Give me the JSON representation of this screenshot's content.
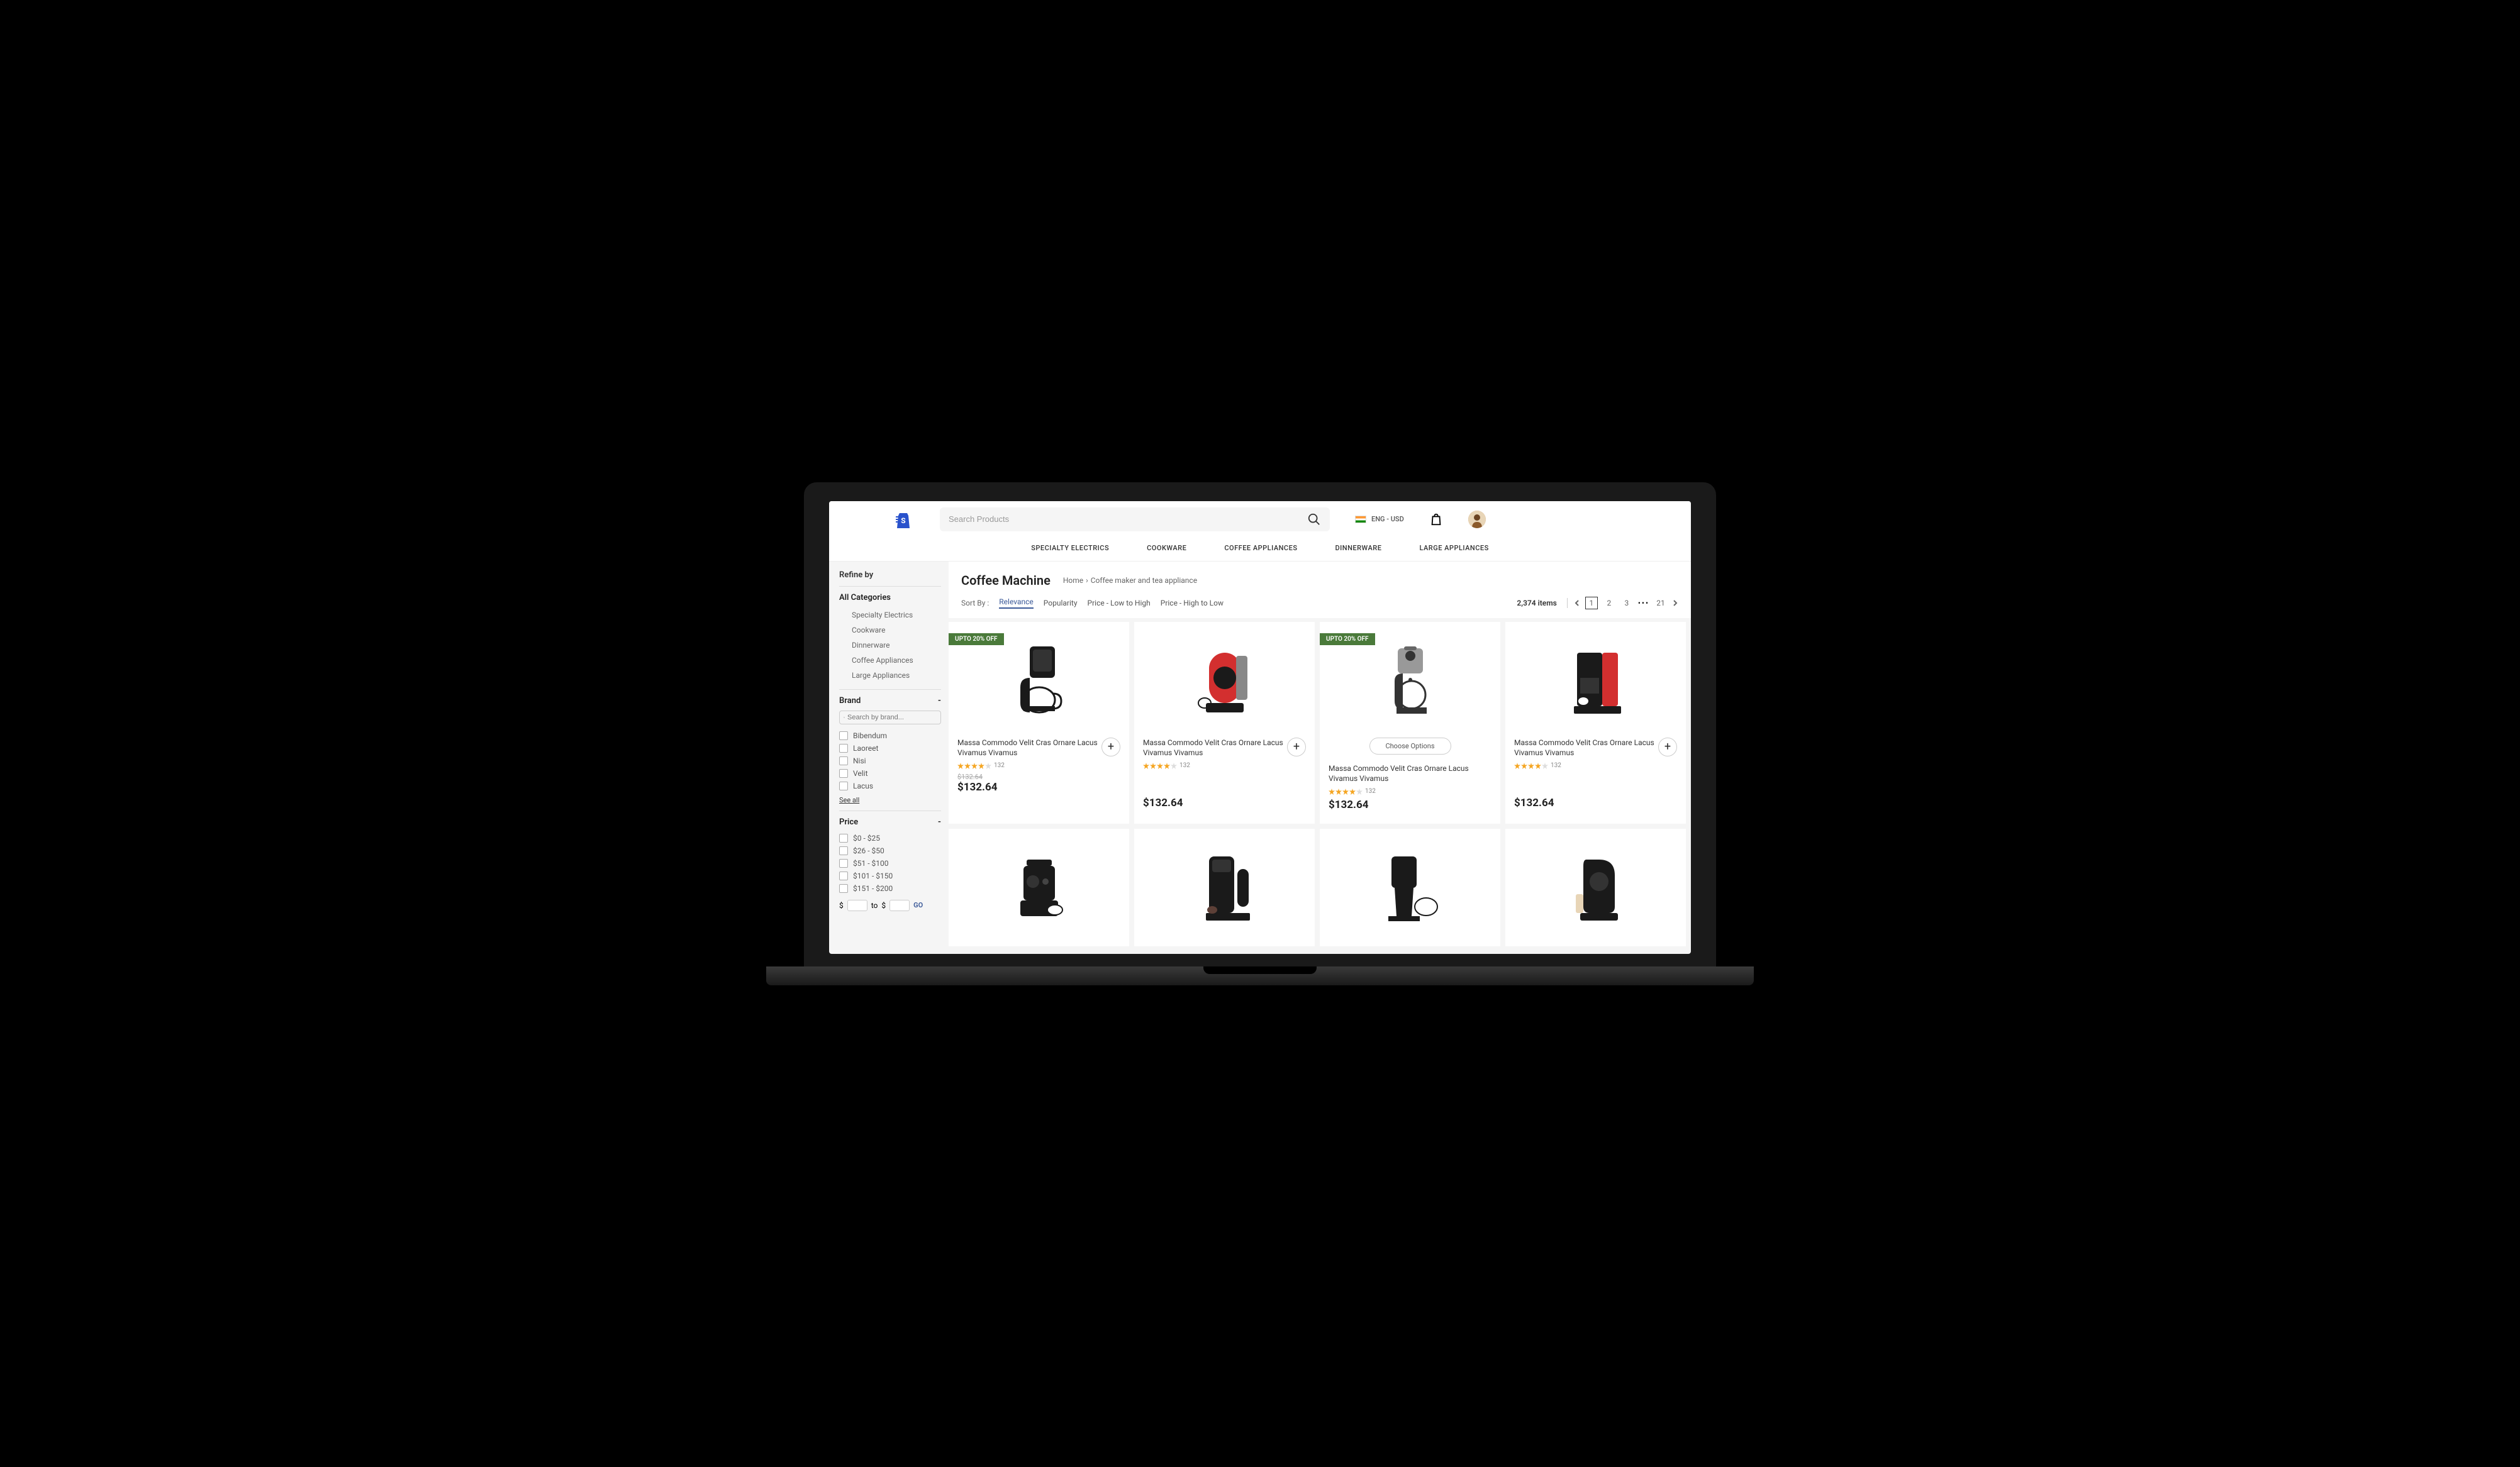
{
  "header": {
    "search_placeholder": "Search Products",
    "locale": "ENG - USD"
  },
  "nav": {
    "items": [
      "SPECIALTY ELECTRICS",
      "COOKWARE",
      "COFFEE APPLIANCES",
      "DINNERWARE",
      "LARGE APPLIANCES"
    ]
  },
  "sidebar": {
    "refine_label": "Refine by",
    "categories_label": "All Categories",
    "categories": [
      "Specialty Electrics",
      "Cookware",
      "Dinnerware",
      "Coffee Appliances",
      "Large Appliances"
    ],
    "brand_label": "Brand",
    "brand_search_placeholder": "Search by brand...",
    "brands": [
      "Bibendum",
      "Laoreet",
      "Nisi",
      "Velit",
      "Lacus"
    ],
    "see_all": "See all",
    "price_label": "Price",
    "price_ranges": [
      "$0 - $25",
      "$26 - $50",
      "$51 - $100",
      "$101 - $150",
      "$151 - $200"
    ],
    "range_to": "to",
    "go_label": "GO"
  },
  "content": {
    "title": "Coffee Machine",
    "breadcrumb_home": "Home",
    "breadcrumb_current": "Coffee maker and tea appliance",
    "sort_label": "Sort By  :",
    "sort_options": [
      "Relevance",
      "Popularity",
      "Price - Low to High",
      "Price - High to Low"
    ],
    "item_count": "2,374 items",
    "pages": [
      "1",
      "2",
      "3"
    ],
    "last_page": "21"
  },
  "products": [
    {
      "badge": "UPTO 20% OFF",
      "name": "Massa Commodo Velit Cras Ornare Lacus Vivamus Vivamus",
      "reviews": "132",
      "old_price": "$132.64",
      "price": "$132.64",
      "action": "add"
    },
    {
      "badge": "",
      "name": "Massa Commodo Velit Cras Ornare Lacus Vivamus Vivamus",
      "reviews": "132",
      "old_price": "",
      "price": "$132.64",
      "action": "add"
    },
    {
      "badge": "UPTO 20% OFF",
      "name": "Massa Commodo Velit Cras Ornare Lacus Vivamus Vivamus",
      "reviews": "132",
      "old_price": "",
      "price": "$132.64",
      "action": "choose",
      "choose_label": "Choose Options"
    },
    {
      "badge": "",
      "name": "Massa Commodo Velit Cras Ornare Lacus Vivamus Vivamus",
      "reviews": "132",
      "old_price": "",
      "price": "$132.64",
      "action": "add"
    }
  ]
}
